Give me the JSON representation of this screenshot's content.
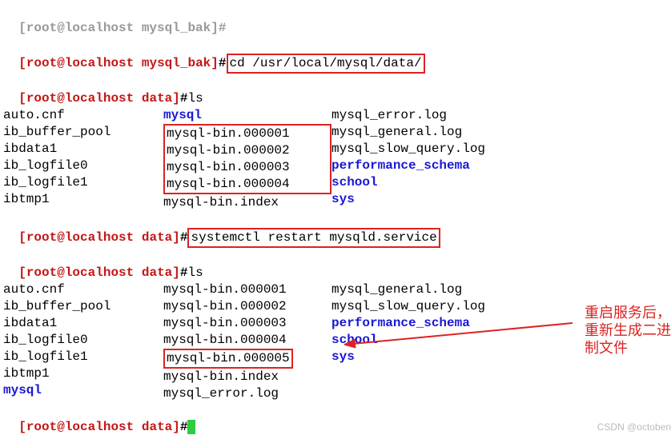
{
  "prompt": {
    "user": "root",
    "host": "localhost"
  },
  "dirs": {
    "bak": "mysql_bak",
    "data": "data"
  },
  "cmds": {
    "cd": "cd /usr/local/mysql/data/",
    "ls1": "ls",
    "restart": "systemctl restart mysqld.service",
    "ls2": "ls"
  },
  "top_cut": {
    "prefix": "[root@localhost ",
    "dir": "mysql_bak",
    "tail": "]#"
  },
  "ls1": {
    "col1": [
      "auto.cnf",
      "ib_buffer_pool",
      "ibdata1",
      "ib_logfile0",
      "ib_logfile1",
      "ibtmp1"
    ],
    "col2_dir_first": "mysql",
    "col2_box": [
      "mysql-bin.000001",
      "mysql-bin.000002",
      "mysql-bin.000003",
      "mysql-bin.000004"
    ],
    "col2_after": "mysql-bin.index",
    "col3": [
      {
        "t": "mysql_error.log",
        "d": false
      },
      {
        "t": "mysql_general.log",
        "d": false
      },
      {
        "t": "mysql_slow_query.log",
        "d": false
      },
      {
        "t": "performance_schema",
        "d": true
      },
      {
        "t": "school",
        "d": true
      },
      {
        "t": "sys",
        "d": true
      }
    ]
  },
  "ls2": {
    "col1": [
      {
        "t": "auto.cnf",
        "d": false
      },
      {
        "t": "ib_buffer_pool",
        "d": false
      },
      {
        "t": "ibdata1",
        "d": false
      },
      {
        "t": "ib_logfile0",
        "d": false
      },
      {
        "t": "ib_logfile1",
        "d": false
      },
      {
        "t": "ibtmp1",
        "d": false
      },
      {
        "t": "mysql",
        "d": true
      }
    ],
    "col2": [
      "mysql-bin.000001",
      "mysql-bin.000002",
      "mysql-bin.000003",
      "mysql-bin.000004",
      "mysql-bin.000005",
      "mysql-bin.index",
      "mysql_error.log"
    ],
    "col2_new_index": 4,
    "col3": [
      {
        "t": "mysql_general.log",
        "d": false
      },
      {
        "t": "mysql_slow_query.log",
        "d": false
      },
      {
        "t": "performance_schema",
        "d": true
      },
      {
        "t": "school",
        "d": true
      },
      {
        "t": "sys",
        "d": true
      }
    ]
  },
  "annotation": "重启服务后，重新生成二进制文件",
  "watermark": "CSDN @octoben"
}
